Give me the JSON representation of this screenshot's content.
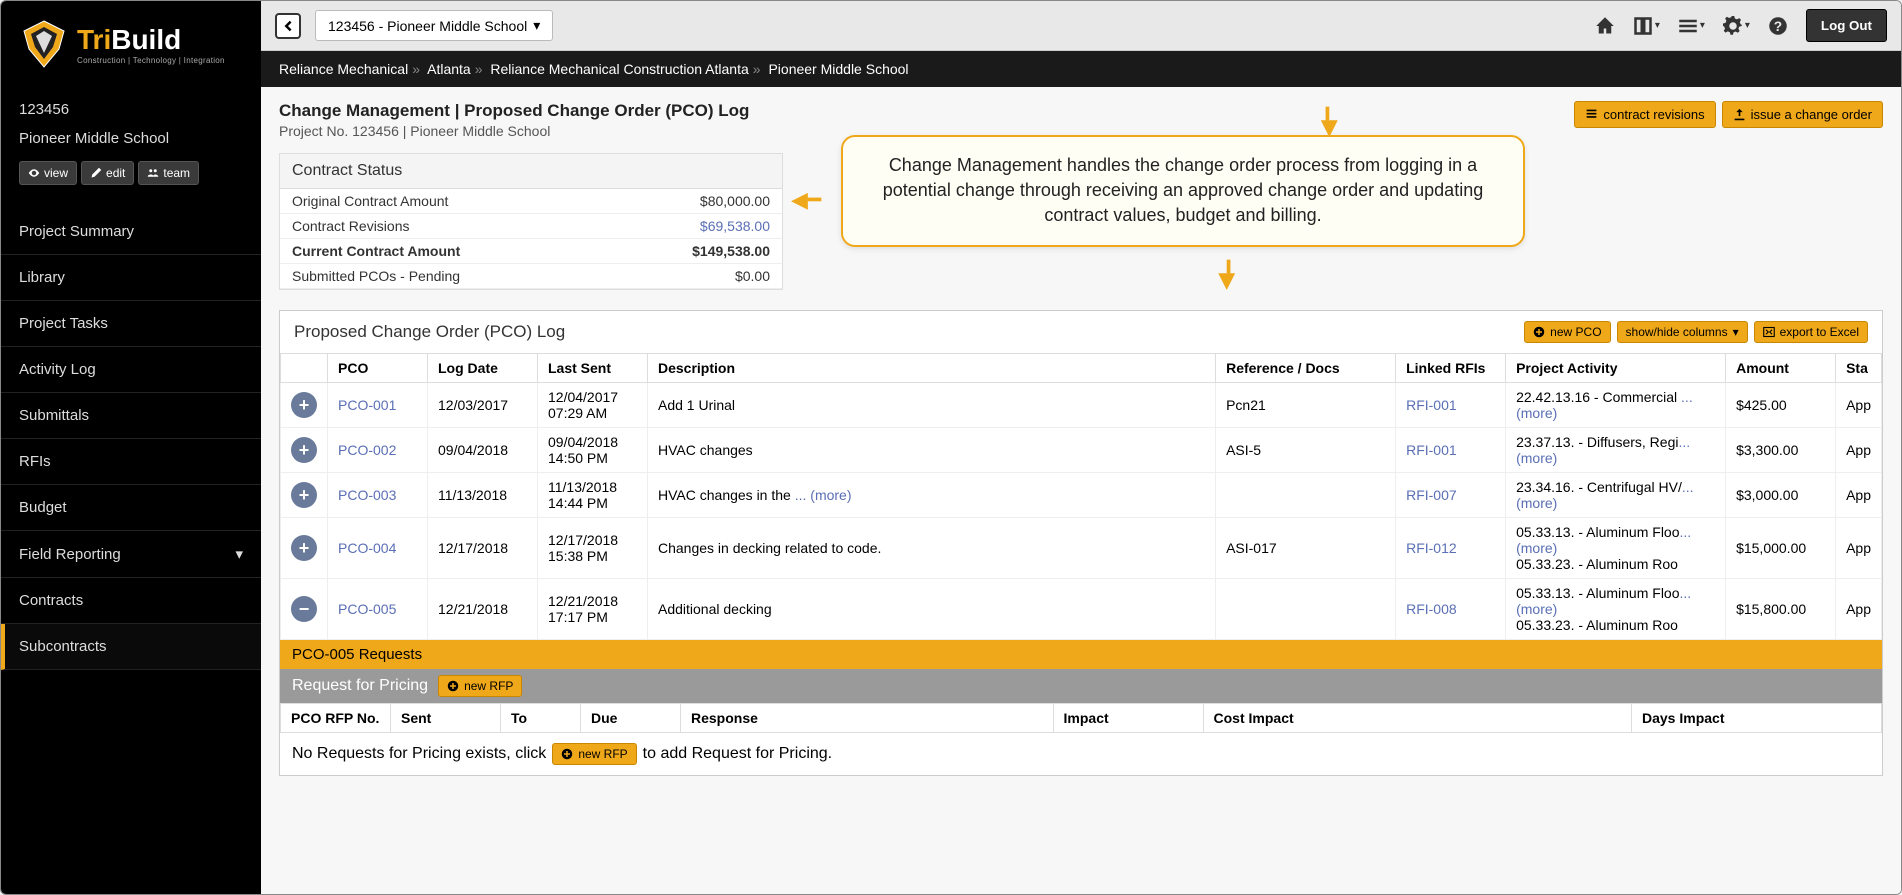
{
  "logo": {
    "brand_tri": "Tri",
    "brand_build": "Build",
    "tagline": "Construction | Technology | Integration"
  },
  "topbar": {
    "project_selector": "123456 - Pioneer Middle School",
    "logout": "Log Out"
  },
  "breadcrumb": [
    "Reliance Mechanical",
    "Atlanta",
    "Reliance Mechanical Construction Atlanta",
    "Pioneer Middle School"
  ],
  "sidebar": {
    "project_number": "123456",
    "project_name": "Pioneer Middle School",
    "buttons": {
      "view": "view",
      "edit": "edit",
      "team": "team"
    },
    "nav": [
      "Project Summary",
      "Library",
      "Project Tasks",
      "Activity Log",
      "Submittals",
      "RFIs",
      "Budget",
      "Field Reporting",
      "Contracts",
      "Subcontracts"
    ]
  },
  "page": {
    "title": "Change Management | Proposed Change Order (PCO) Log",
    "subtitle": "Project No. 123456 | Pioneer Middle School",
    "btn_revisions": "contract revisions",
    "btn_issue": "issue a change order"
  },
  "contract_status": {
    "title": "Contract Status",
    "rows": [
      {
        "label": "Original Contract Amount",
        "value": "$80,000.00"
      },
      {
        "label": "Contract Revisions",
        "value": "$69,538.00",
        "link": true
      },
      {
        "label": "Current Contract Amount",
        "value": "$149,538.00",
        "bold": true
      },
      {
        "label": "Submitted PCOs - Pending",
        "value": "$0.00"
      }
    ]
  },
  "callout": "Change Management handles the change order process from logging in a potential change through receiving an approved change order and updating  contract values, budget and billing.",
  "pco_log": {
    "title": "Proposed Change Order (PCO) Log",
    "btns": {
      "new": "new PCO",
      "columns": "show/hide columns",
      "export": "export to Excel"
    },
    "headers": [
      "",
      "PCO",
      "Log Date",
      "Last Sent",
      "Description",
      "Reference / Docs",
      "Linked RFIs",
      "Project Activity",
      "Amount",
      "Sta"
    ],
    "rows": [
      {
        "icon": "plus",
        "pco": "PCO-001",
        "log": "12/03/2017",
        "sent": "12/04/2017 07:29 AM",
        "desc": "Add 1 Urinal",
        "ref": "Pcn21",
        "rfi": "RFI-001",
        "activity": "22.42.13.16 - Commercial ",
        "more": "... (more)",
        "amount": "$425.00",
        "status": "App"
      },
      {
        "icon": "plus",
        "pco": "PCO-002",
        "log": "09/04/2018",
        "sent": "09/04/2018 14:50 PM",
        "desc": "HVAC changes",
        "ref": "ASI-5",
        "rfi": "RFI-001",
        "activity": "23.37.13. - Diffusers, Regi",
        "more": "... (more)",
        "amount": "$3,300.00",
        "status": "App"
      },
      {
        "icon": "plus",
        "pco": "PCO-003",
        "log": "11/13/2018",
        "sent": "11/13/2018 14:44 PM",
        "desc": "HVAC changes in the ",
        "desc_more": "... (more)",
        "ref": "",
        "rfi": "RFI-007",
        "activity": "23.34.16. - Centrifugal HV/",
        "more": "... (more)",
        "amount": "$3,000.00",
        "status": "App"
      },
      {
        "icon": "plus",
        "pco": "PCO-004",
        "log": "12/17/2018",
        "sent": "12/17/2018 15:38 PM",
        "desc": "Changes in decking related to code.",
        "ref": "ASI-017",
        "rfi": "RFI-012",
        "activity": "05.33.13. - Aluminum Floo",
        "more": "... (more)",
        "activity2": "05.33.23. - Aluminum Roo",
        "amount": "$15,000.00",
        "status": "App"
      },
      {
        "icon": "minus",
        "pco": "PCO-005",
        "log": "12/21/2018",
        "sent": "12/21/2018 17:17 PM",
        "desc": "Additional decking",
        "ref": "",
        "rfi": "RFI-008",
        "activity": "05.33.13. - Aluminum Floo",
        "more": "... (more)",
        "activity2": "05.33.23. - Aluminum Roo",
        "amount": "$15,800.00",
        "status": "App"
      }
    ]
  },
  "requests": {
    "bar_title": "PCO-005 Requests",
    "rfp_title": "Request for Pricing",
    "btn_new_rfp": "new RFP",
    "headers": [
      "PCO RFP No.",
      "Sent",
      "To",
      "Due",
      "Response",
      "Impact",
      "Cost Impact",
      "Days Impact"
    ],
    "empty_prefix": "No Requests for Pricing exists, click",
    "empty_suffix": "to add Request for Pricing."
  }
}
